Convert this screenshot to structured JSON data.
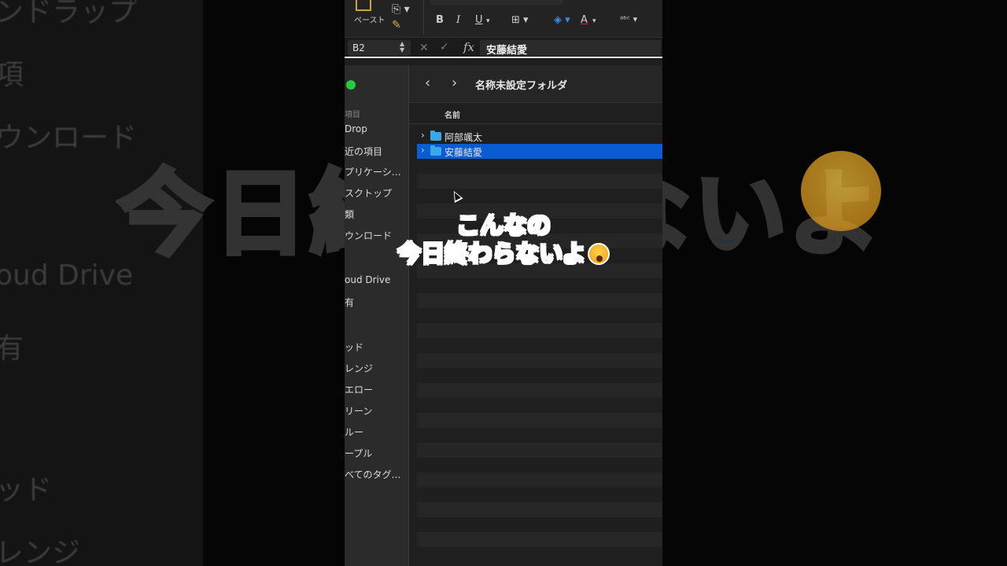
{
  "ribbon": {
    "paste_label": "ペースト",
    "bold": "B",
    "italic": "I",
    "underline": "U",
    "font_color_glyph": "A"
  },
  "formula_bar": {
    "cell_ref": "B2",
    "fx": "fx",
    "value": "安藤結愛"
  },
  "finder": {
    "title": "名称未設定フォルダ",
    "column_name": "名前",
    "sidebar": {
      "favorites_heading": "項目",
      "items": [
        "Drop",
        "近の項目",
        "プリケーシ…",
        "スクトップ",
        "類",
        "ウンロード",
        "oud Drive",
        "有",
        "ッド",
        "レンジ",
        "エロー",
        "リーン",
        "ルー",
        "ープル",
        "べてのタグ…"
      ]
    },
    "rows": [
      {
        "label": "阿部颯太",
        "selected": false
      },
      {
        "label": "安藤結愛",
        "selected": true
      }
    ]
  },
  "caption": {
    "line1": "こんなの",
    "line2": "今日終わらないよ"
  },
  "background": {
    "left_items": [
      "ンドラップ",
      "項",
      "ウンロード",
      "oud Drive",
      "有",
      "ッド",
      "レンジ"
    ],
    "big_text": "今日終わらないよ"
  },
  "colors": {
    "selection": "#0b5bd3",
    "folder": "#3aa8e8",
    "caption": "#1d8bff",
    "traffic_green": "#2ac840"
  }
}
